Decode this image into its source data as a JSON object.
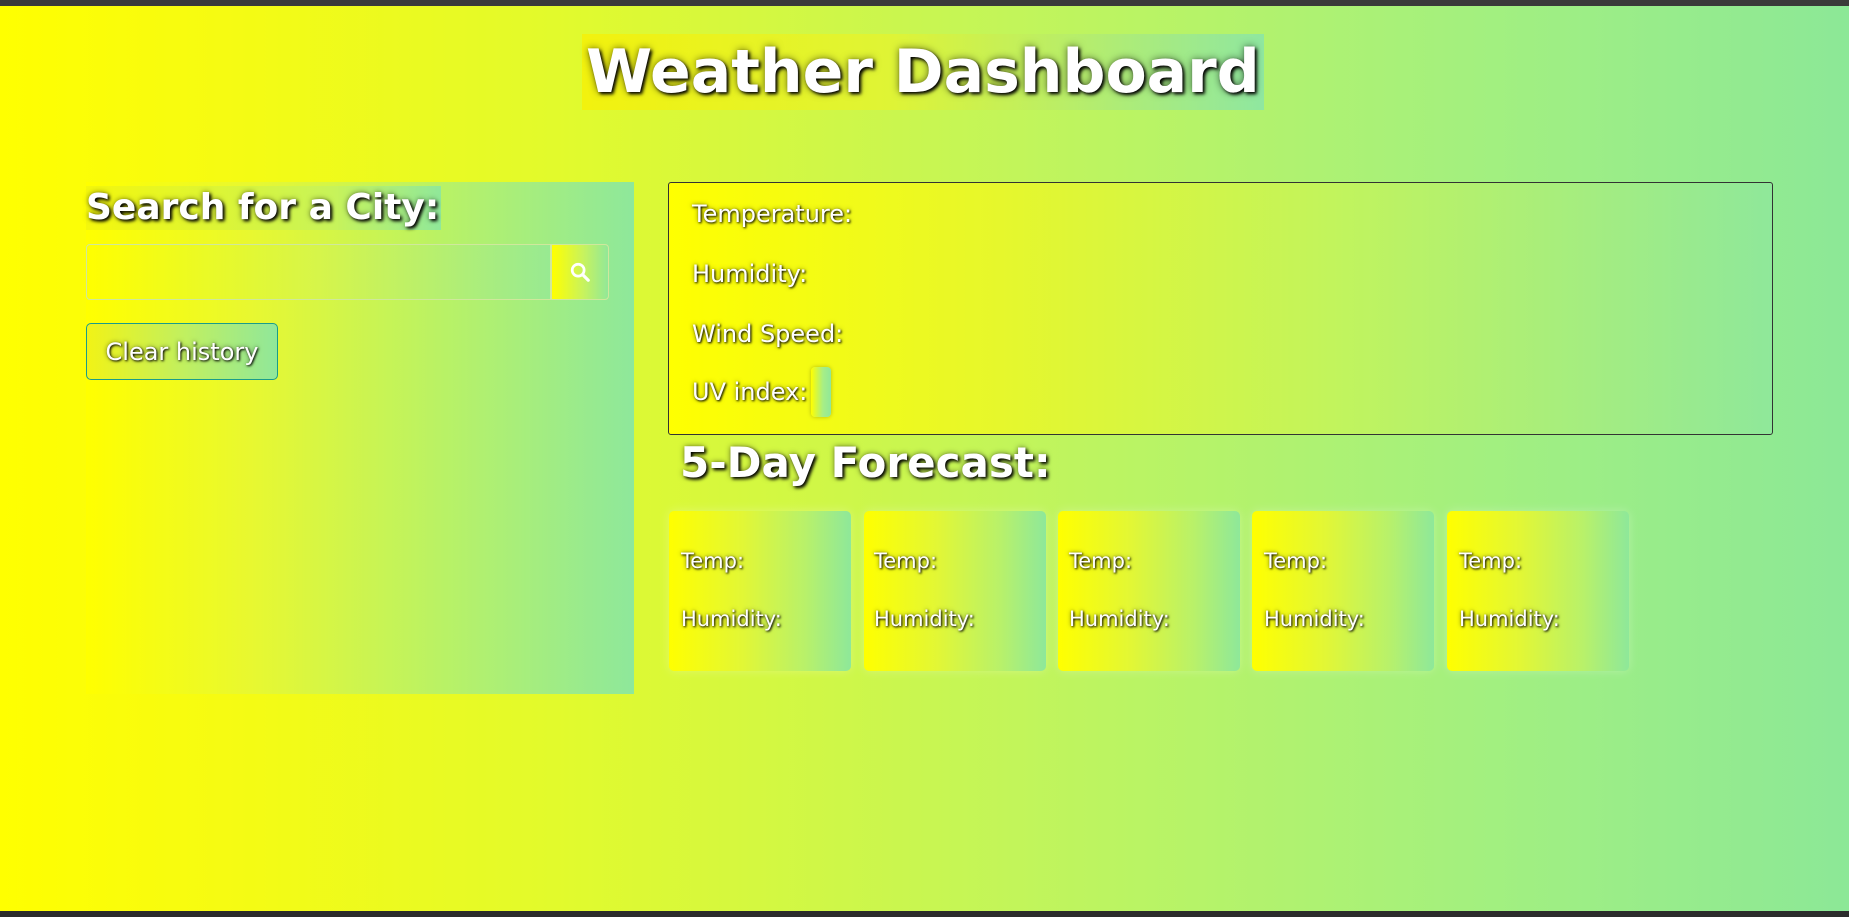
{
  "header": {
    "title": "Weather Dashboard"
  },
  "search": {
    "label": "Search for a City:",
    "input_value": "",
    "placeholder": "",
    "clear_label": "Clear history"
  },
  "current": {
    "temperature_label": "Temperature:",
    "humidity_label": "Humidity:",
    "wind_label": "Wind Speed:",
    "uv_label": "UV index:"
  },
  "forecast": {
    "title": "5-Day Forecast:",
    "cards": [
      {
        "temp_label": "Temp:",
        "humidity_label": "Humidity:"
      },
      {
        "temp_label": "Temp:",
        "humidity_label": "Humidity:"
      },
      {
        "temp_label": "Temp:",
        "humidity_label": "Humidity:"
      },
      {
        "temp_label": "Temp:",
        "humidity_label": "Humidity:"
      },
      {
        "temp_label": "Temp:",
        "humidity_label": "Humidity:"
      }
    ]
  },
  "theme": {
    "gradient_start": "#ffff00",
    "gradient_end": "#8ce897",
    "text_color": "#ffffff",
    "border_accent": "#1a9c8a"
  },
  "icons": {
    "search_button": "search-icon"
  }
}
